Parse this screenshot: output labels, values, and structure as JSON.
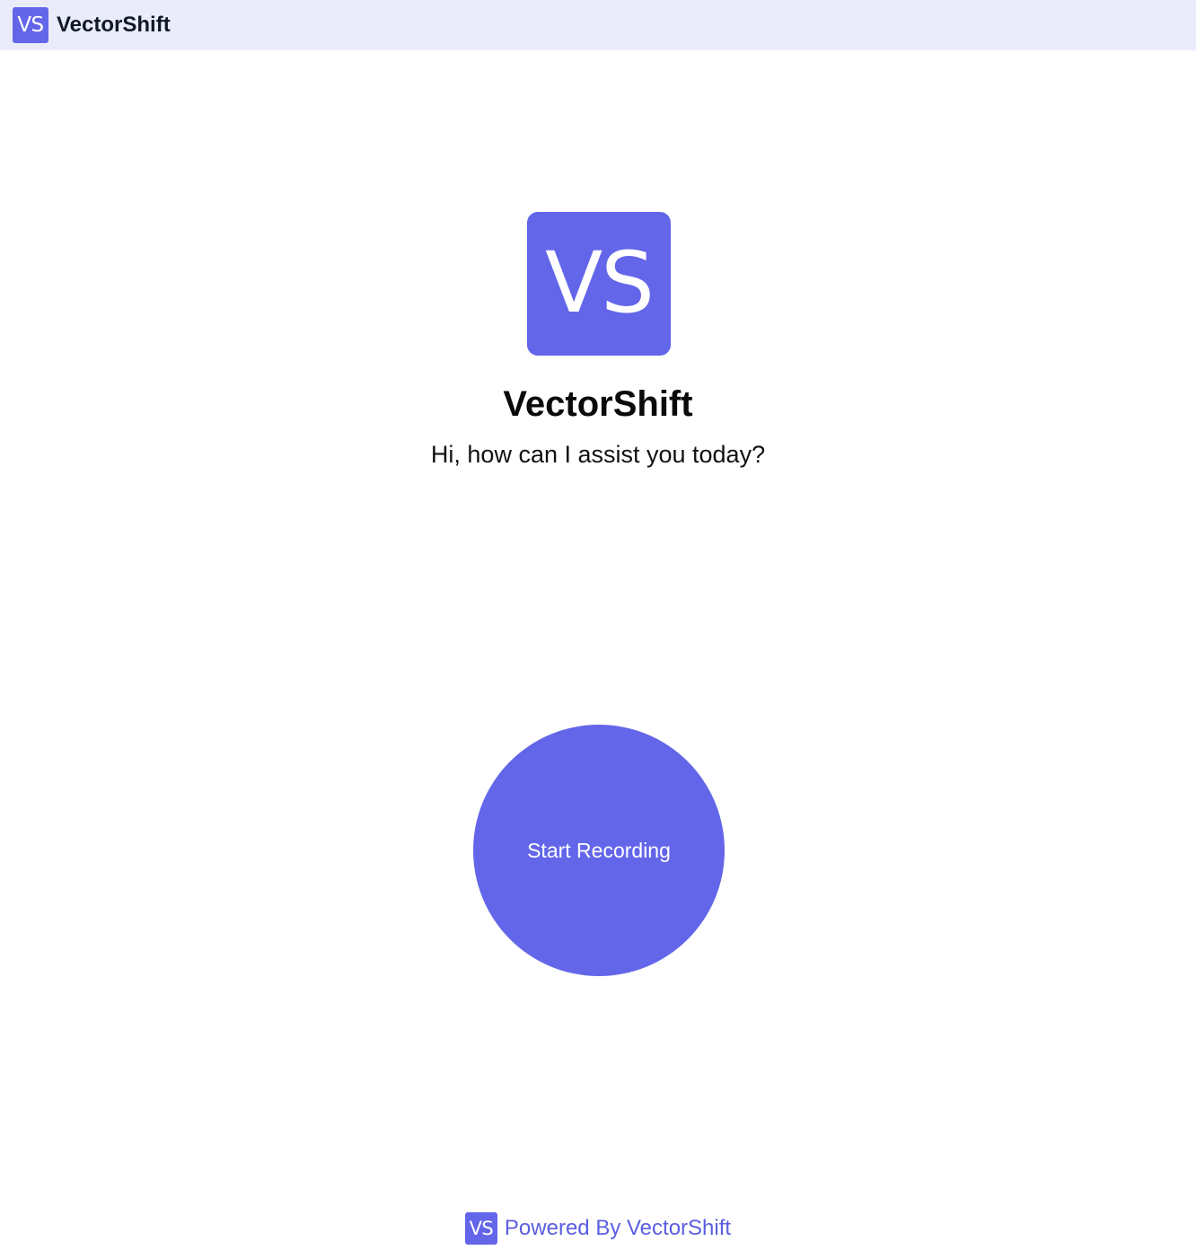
{
  "colors": {
    "accent": "#6366E9",
    "topbar_background": "#EAECFB",
    "footer_text": "#5B5EE0"
  },
  "topbar": {
    "logo_text": "VS",
    "title": "VectorShift"
  },
  "hero": {
    "logo_text": "VS",
    "title": "VectorShift",
    "subtitle": "Hi, how can I assist you today?"
  },
  "record_button": {
    "label": "Start Recording"
  },
  "footer": {
    "logo_text": "VS",
    "text": "Powered By VectorShift"
  }
}
